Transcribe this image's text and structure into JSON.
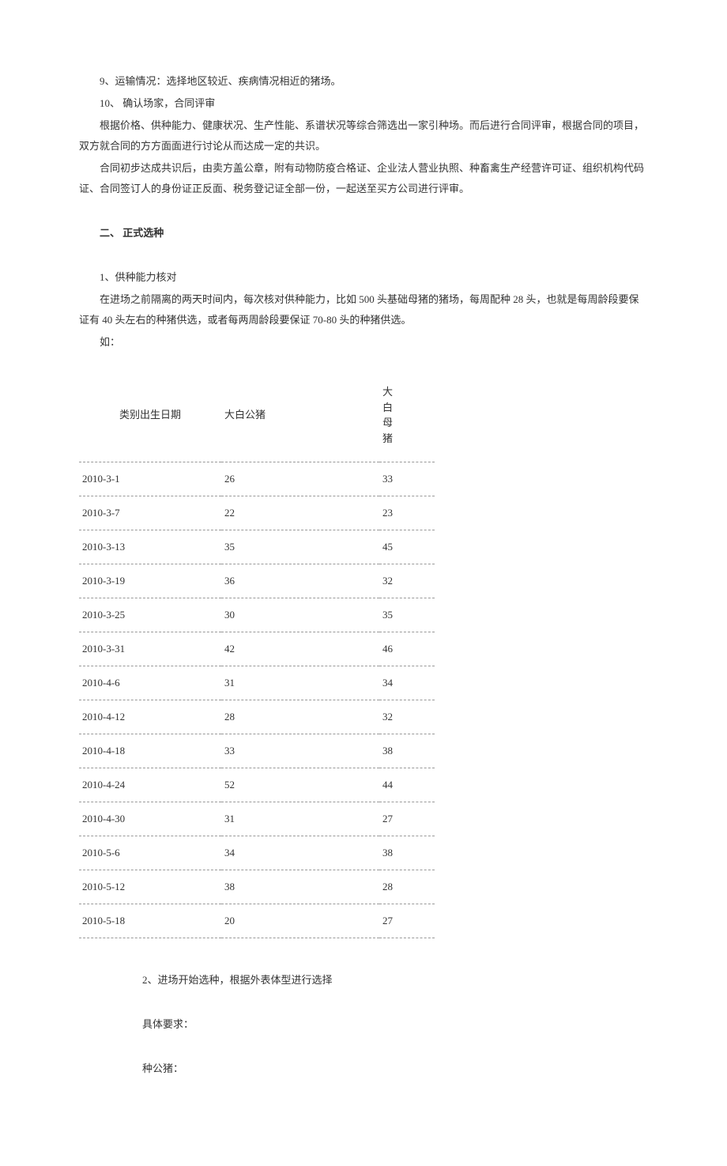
{
  "paragraphs": {
    "p1": "9、运输情况：选择地区较近、疾病情况相近的猪场。",
    "p2": "10、 确认场家，合同评审",
    "p3": "根据价格、供种能力、健康状况、生产性能、系谱状况等综合筛选出一家引种场。而后进行合同评审，根据合同的项目，双方就合同的方方面面进行讨论从而达成一定的共识。",
    "p4": "合同初步达成共识后，由卖方盖公章，附有动物防疫合格证、企业法人营业执照、种畜禽生产经营许可证、组织机构代码证、合同签订人的身份证正反面、税务登记证全部一份，一起送至买方公司进行评审。"
  },
  "section2": {
    "title": "二、 正式选种",
    "item1": "1、供种能力核对",
    "desc1": "在进场之前隔离的两天时间内，每次核对供种能力，比如 500 头基础母猪的猪场，每周配种 28 头，也就是每周龄段要保证有 40 头左右的种猪供选，或者每两周龄段要保证 70-80 头的种猪供选。",
    "example_label": "如："
  },
  "table": {
    "headers": {
      "date": "类别出生日期",
      "male": "大白公猪",
      "female_c1": "大",
      "female_c2": "白",
      "female_c3": "母",
      "female_c4": "猪"
    },
    "rows": [
      {
        "date": "2010-3-1",
        "male": "26",
        "female": "33"
      },
      {
        "date": "2010-3-7",
        "male": "22",
        "female": "23"
      },
      {
        "date": "2010-3-13",
        "male": "35",
        "female": "45"
      },
      {
        "date": "2010-3-19",
        "male": "36",
        "female": "32"
      },
      {
        "date": "2010-3-25",
        "male": "30",
        "female": "35"
      },
      {
        "date": "2010-3-31",
        "male": "42",
        "female": "46"
      },
      {
        "date": "2010-4-6",
        "male": "31",
        "female": "34"
      },
      {
        "date": "2010-4-12",
        "male": "28",
        "female": "32"
      },
      {
        "date": "2010-4-18",
        "male": "33",
        "female": "38"
      },
      {
        "date": "2010-4-24",
        "male": "52",
        "female": "44"
      },
      {
        "date": "2010-4-30",
        "male": "31",
        "female": "27"
      },
      {
        "date": "2010-5-6",
        "male": "34",
        "female": "38"
      },
      {
        "date": "2010-5-12",
        "male": "38",
        "female": "28"
      },
      {
        "date": "2010-5-18",
        "male": "20",
        "female": "27"
      }
    ]
  },
  "section2b": {
    "item2": "2、进场开始选种，根据外表体型进行选择",
    "req_label": "具体要求：",
    "boar_label": "种公猪："
  }
}
